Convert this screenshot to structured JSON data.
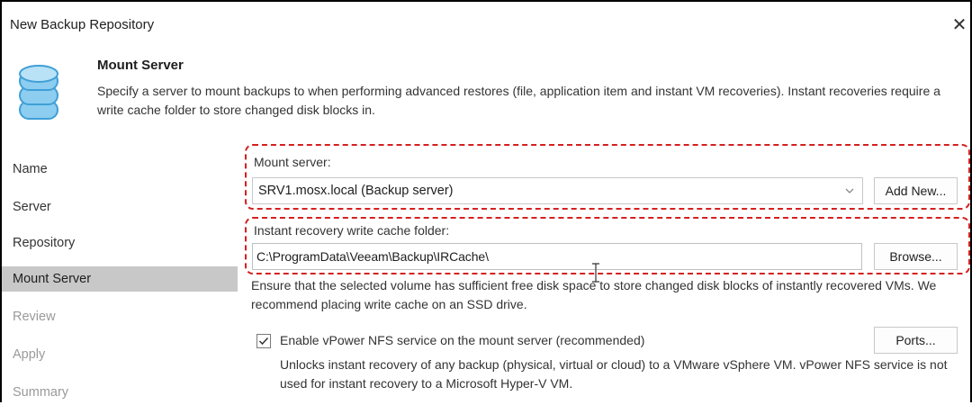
{
  "window": {
    "title": "New Backup Repository",
    "close_glyph": "✕"
  },
  "header": {
    "icon": "database-icon",
    "title": "Mount Server",
    "description": "Specify a server to mount backups to when performing advanced restores (file, application item and instant VM recoveries). Instant recoveries require a write cache folder to store changed disk blocks in."
  },
  "sidebar": {
    "items": [
      {
        "label": "Name",
        "state": "done"
      },
      {
        "label": "Server",
        "state": "done"
      },
      {
        "label": "Repository",
        "state": "done"
      },
      {
        "label": "Mount Server",
        "state": "active"
      },
      {
        "label": "Review",
        "state": "disabled"
      },
      {
        "label": "Apply",
        "state": "disabled"
      },
      {
        "label": "Summary",
        "state": "disabled"
      }
    ]
  },
  "mount_server": {
    "label": "Mount server:",
    "value": "SRV1.mosx.local (Backup server)",
    "add_new_label": "Add New..."
  },
  "cache_folder": {
    "label": "Instant recovery write cache folder:",
    "value": "C:\\ProgramData\\Veeam\\Backup\\IRCache\\",
    "browse_label": "Browse...",
    "note": "Ensure that the selected volume has sufficient free disk space to store changed disk blocks of instantly recovered VMs. We recommend placing write cache on an SSD drive."
  },
  "nfs": {
    "checked": true,
    "label": "Enable vPower NFS service on the mount server (recommended)",
    "ports_label": "Ports...",
    "note": "Unlocks instant recovery of any backup (physical, virtual or cloud) to a VMware vSphere VM. vPower NFS service is not used for instant recovery to a Microsoft Hyper-V VM."
  },
  "colors": {
    "highlight": "#d42020",
    "active_nav": "#c8c8c8",
    "icon_blue": "#5aaedc"
  }
}
